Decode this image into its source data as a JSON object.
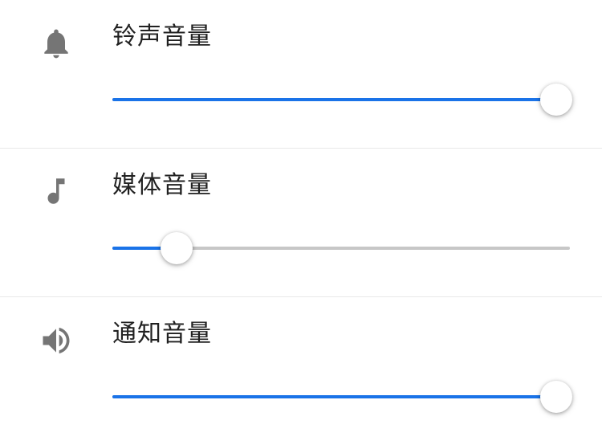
{
  "settings": {
    "items": [
      {
        "id": "ringtone",
        "label": "铃声音量",
        "icon": "bell-icon",
        "value": 97
      },
      {
        "id": "media",
        "label": "媒体音量",
        "icon": "music-note-icon",
        "value": 14
      },
      {
        "id": "notification",
        "label": "通知音量",
        "icon": "speaker-icon",
        "value": 97
      }
    ]
  },
  "colors": {
    "accent": "#1a73e8",
    "track": "#c7c7c7",
    "icon": "#757575",
    "text": "#212121"
  }
}
